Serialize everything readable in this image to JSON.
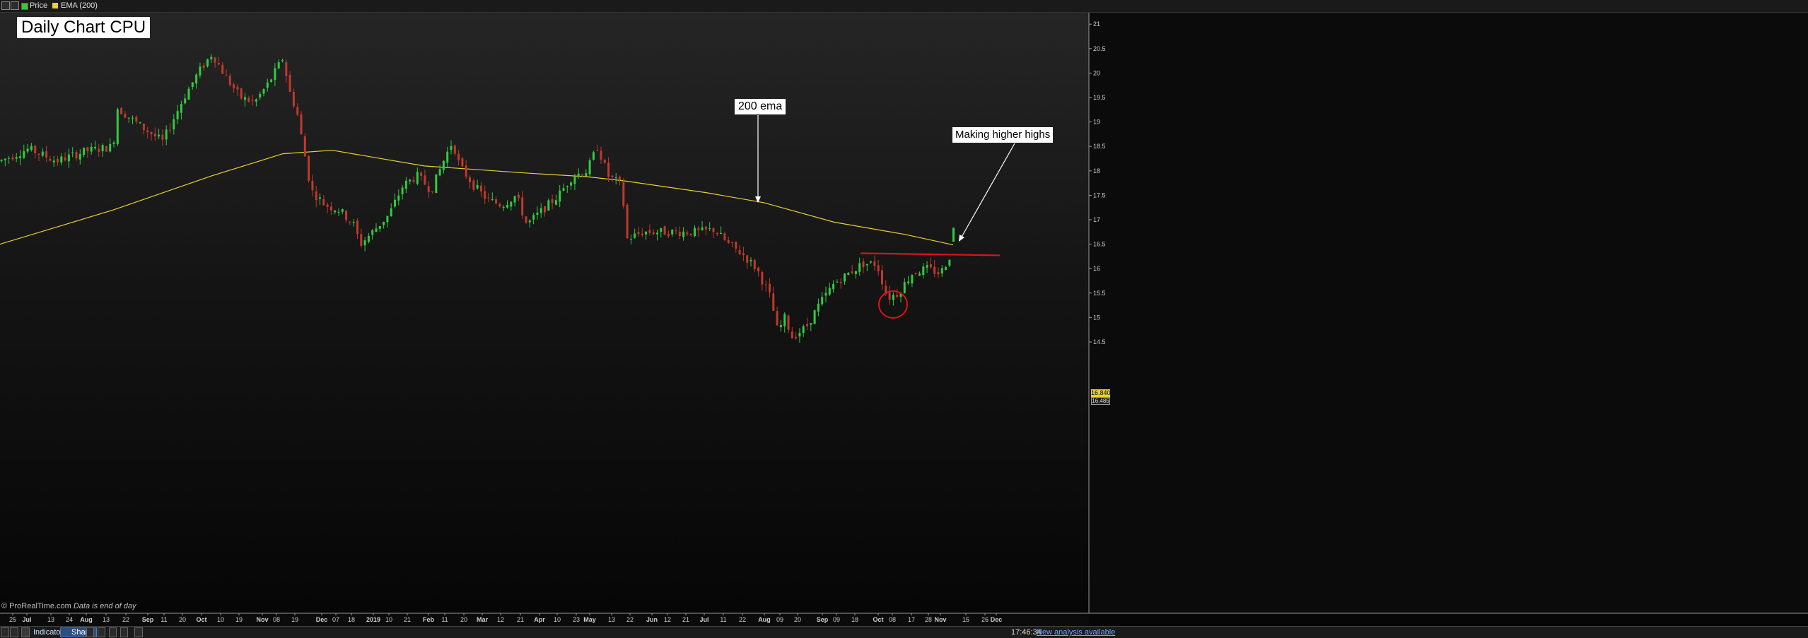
{
  "toolbar": {
    "legend_price": "Price",
    "legend_ema": "EMA (200)",
    "price_color": "#2ecc40",
    "ema_color": "#e8d130"
  },
  "annotations": {
    "title": "Daily Chart CPU",
    "ema_note": "200 ema",
    "highs_note": "Making higher highs"
  },
  "price_tags": {
    "last": "16.840",
    "ema": "16.485"
  },
  "watermark": {
    "source": "© ProRealTime.com",
    "note": "Data is end of day"
  },
  "bottom_bar": {
    "indicators_label": "Indicators",
    "share_label": "Share",
    "clock": "17:46:34",
    "new_analysis_link": "New analysis available"
  },
  "chart_data": {
    "type": "candlestick",
    "ylim": [
      14.2,
      21.35
    ],
    "y_ticks": [
      "14.5",
      "15",
      "15.5",
      "16",
      "16.5",
      "17",
      "17.5",
      "18",
      "18.5",
      "19",
      "19.5",
      "20",
      "20.5",
      "21"
    ],
    "x_ticks": [
      "25",
      "Jul",
      "13",
      "24",
      "Aug",
      "13",
      "22",
      "Sep",
      "11",
      "20",
      "Oct",
      "10",
      "19",
      "Nov",
      "08",
      "19",
      "Dec",
      "07",
      "18",
      "2019",
      "10",
      "21",
      "Feb",
      "11",
      "20",
      "Mar",
      "12",
      "21",
      "Apr",
      "10",
      "23",
      "May",
      "13",
      "22",
      "Jun",
      "12",
      "21",
      "Jul",
      "11",
      "22",
      "Aug",
      "09",
      "20",
      "Sep",
      "09",
      "18",
      "Oct",
      "08",
      "17",
      "28",
      "Nov",
      "15",
      "26",
      "Dec"
    ],
    "ema_series": {
      "name": "EMA (200)",
      "points": [
        [
          0,
          16.5
        ],
        [
          160,
          17.2
        ],
        [
          300,
          17.9
        ],
        [
          400,
          18.35
        ],
        [
          470,
          18.42
        ],
        [
          600,
          18.1
        ],
        [
          750,
          17.95
        ],
        [
          830,
          17.88
        ],
        [
          880,
          17.8
        ],
        [
          1000,
          17.55
        ],
        [
          1080,
          17.35
        ],
        [
          1180,
          16.95
        ],
        [
          1280,
          16.7
        ],
        [
          1348,
          16.485
        ]
      ]
    },
    "price_points": [
      [
        0,
        18.2
      ],
      [
        40,
        18.45
      ],
      [
        80,
        18.2
      ],
      [
        120,
        18.4
      ],
      [
        160,
        18.5
      ],
      [
        165,
        19.3
      ],
      [
        200,
        18.9
      ],
      [
        230,
        18.6
      ],
      [
        260,
        19.5
      ],
      [
        280,
        20.0
      ],
      [
        300,
        20.4
      ],
      [
        320,
        19.9
      ],
      [
        340,
        19.5
      ],
      [
        360,
        19.4
      ],
      [
        380,
        19.8
      ],
      [
        400,
        20.3
      ],
      [
        410,
        19.6
      ],
      [
        420,
        19.2
      ],
      [
        430,
        18.4
      ],
      [
        440,
        17.6
      ],
      [
        460,
        17.3
      ],
      [
        480,
        17.2
      ],
      [
        500,
        16.9
      ],
      [
        510,
        16.5
      ],
      [
        530,
        16.8
      ],
      [
        550,
        17.1
      ],
      [
        570,
        17.7
      ],
      [
        590,
        17.9
      ],
      [
        610,
        17.6
      ],
      [
        630,
        18.3
      ],
      [
        640,
        18.6
      ],
      [
        650,
        18.1
      ],
      [
        670,
        17.7
      ],
      [
        690,
        17.4
      ],
      [
        710,
        17.3
      ],
      [
        730,
        17.5
      ],
      [
        745,
        16.9
      ],
      [
        760,
        17.1
      ],
      [
        790,
        17.5
      ],
      [
        810,
        17.9
      ],
      [
        830,
        18.0
      ],
      [
        845,
        18.5
      ],
      [
        860,
        17.9
      ],
      [
        880,
        17.7
      ],
      [
        885,
        16.6
      ],
      [
        910,
        16.75
      ],
      [
        950,
        16.75
      ],
      [
        990,
        16.75
      ],
      [
        1010,
        16.8
      ],
      [
        1030,
        16.5
      ],
      [
        1050,
        16.3
      ],
      [
        1070,
        16.0
      ],
      [
        1090,
        15.4
      ],
      [
        1100,
        14.7
      ],
      [
        1110,
        15.0
      ],
      [
        1120,
        14.6
      ],
      [
        1140,
        14.8
      ],
      [
        1160,
        15.3
      ],
      [
        1180,
        15.7
      ],
      [
        1200,
        15.9
      ],
      [
        1220,
        16.1
      ],
      [
        1240,
        16.1
      ],
      [
        1255,
        15.4
      ],
      [
        1270,
        15.5
      ],
      [
        1290,
        15.9
      ],
      [
        1310,
        16.0
      ],
      [
        1330,
        15.9
      ],
      [
        1345,
        16.3
      ],
      [
        1350,
        16.84
      ]
    ],
    "resistance_level": 16.3,
    "last_price": 16.84,
    "ema_value": 16.485
  }
}
